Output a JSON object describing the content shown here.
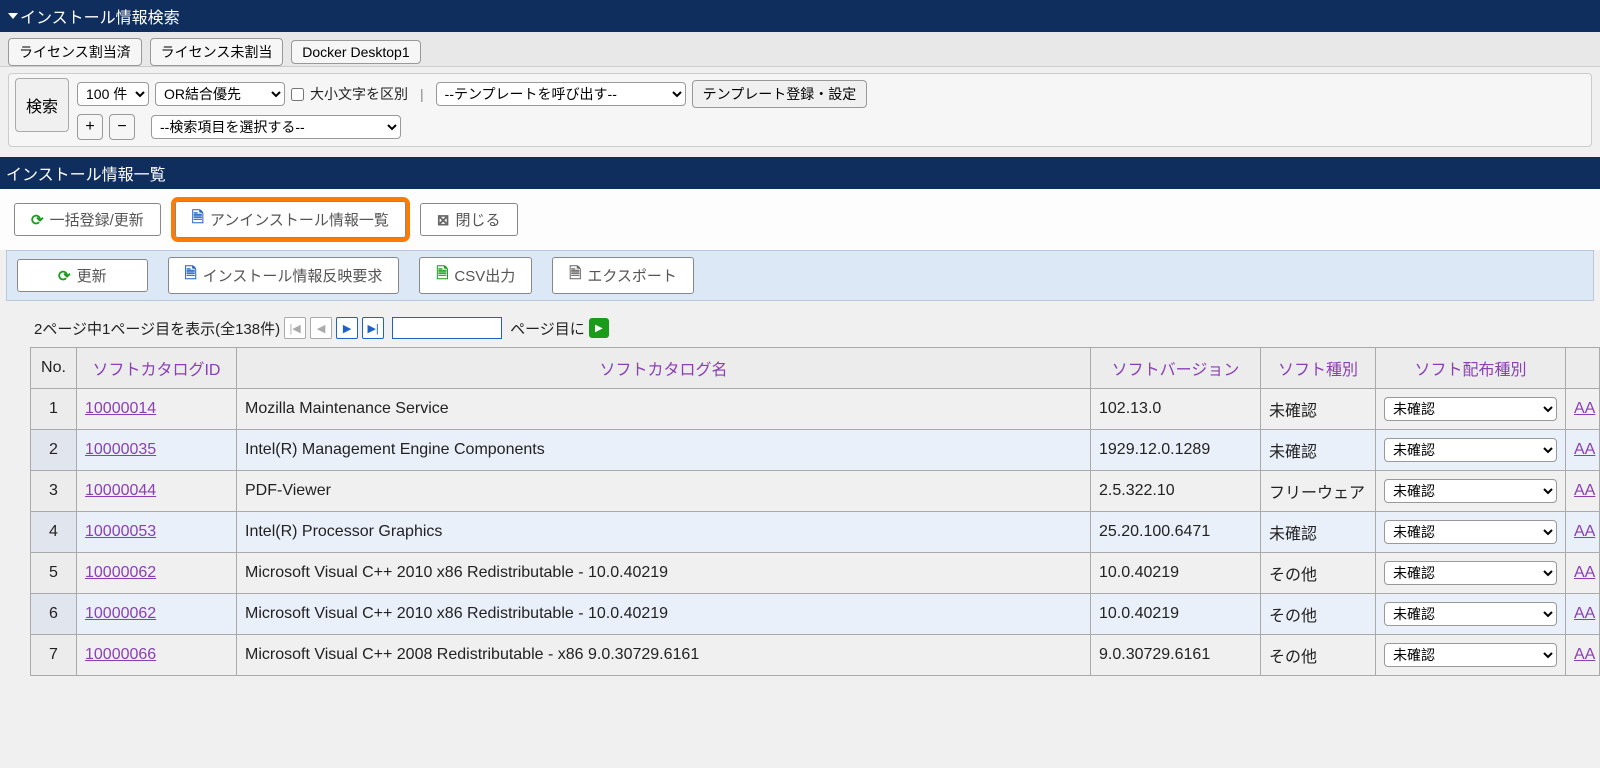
{
  "search_section": {
    "title": "インストール情報検索",
    "tabs": [
      "ライセンス割当済",
      "ライセンス未割当",
      "Docker Desktop1"
    ],
    "search_btn": "検索",
    "per_page": "100 件",
    "combine": "OR結合優先",
    "case_label": "大小文字を区別",
    "template_call": "--テンプレートを呼び出す--",
    "template_register": "テンプレート登録・設定",
    "field_select": "--検索項目を選択する--"
  },
  "list_section": {
    "title": "インストール情報一覧",
    "btn_bulk": "一括登録/更新",
    "btn_uninstall": "アンインストール情報一覧",
    "btn_close": "閉じる",
    "btn_refresh": "更新",
    "btn_reflect": "インストール情報反映要求",
    "btn_csv": "CSV出力",
    "btn_export": "エクスポート"
  },
  "pager": {
    "text": "2ページ中1ページ目を表示(全138件)",
    "suffix": "ページ目に"
  },
  "table": {
    "headers": {
      "no": "No.",
      "id": "ソフトカタログID",
      "name": "ソフトカタログ名",
      "version": "ソフトバージョン",
      "type": "ソフト種別",
      "dist": "ソフト配布種別"
    },
    "dist_option": "未確認",
    "last_link": "AA",
    "rows": [
      {
        "no": "1",
        "id": "10000014",
        "name": "Mozilla Maintenance Service",
        "ver": "102.13.0",
        "type": "未確認"
      },
      {
        "no": "2",
        "id": "10000035",
        "name": "Intel(R) Management Engine Components",
        "ver": "1929.12.0.1289",
        "type": "未確認"
      },
      {
        "no": "3",
        "id": "10000044",
        "name": "PDF-Viewer",
        "ver": "2.5.322.10",
        "type": "フリーウェア"
      },
      {
        "no": "4",
        "id": "10000053",
        "name": "Intel(R) Processor Graphics",
        "ver": "25.20.100.6471",
        "type": "未確認"
      },
      {
        "no": "5",
        "id": "10000062",
        "name": "Microsoft Visual C++ 2010 x86 Redistributable - 10.0.40219",
        "ver": "10.0.40219",
        "type": "その他"
      },
      {
        "no": "6",
        "id": "10000062",
        "name": "Microsoft Visual C++ 2010 x86 Redistributable - 10.0.40219",
        "ver": "10.0.40219",
        "type": "その他"
      },
      {
        "no": "7",
        "id": "10000066",
        "name": "Microsoft Visual C++ 2008 Redistributable - x86 9.0.30729.6161",
        "ver": "9.0.30729.6161",
        "type": "その他"
      }
    ]
  }
}
